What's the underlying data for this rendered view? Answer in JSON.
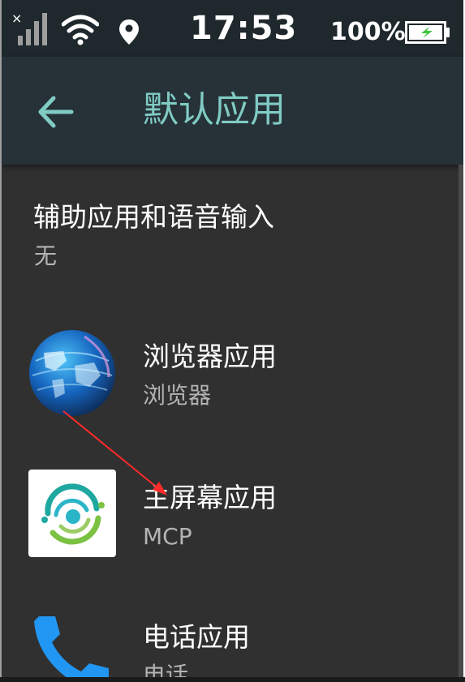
{
  "status_bar": {
    "time": "17:53",
    "battery_percent": "100%",
    "battery_level": 1.0,
    "icons": [
      "signal-no-service-icon",
      "wifi-icon",
      "location-icon",
      "battery-charging-icon"
    ]
  },
  "app_bar": {
    "back_icon": "arrow-back-icon",
    "title": "默认应用"
  },
  "items": [
    {
      "title": "辅助应用和语音输入",
      "subtitle": "无"
    },
    {
      "title": "浏览器应用",
      "subtitle": "浏览器",
      "icon": "browser-globe-icon"
    },
    {
      "title": "主屏幕应用",
      "subtitle": "MCP",
      "icon": "mcp-launcher-icon"
    },
    {
      "title": "电话应用",
      "subtitle": "电话",
      "icon": "phone-icon"
    }
  ],
  "colors": {
    "status_bar_bg": "#1f282c",
    "app_bar_bg": "#263238",
    "accent": "#80cbc4",
    "list_bg": "#303030",
    "annotation_arrow": "#ff2a2a"
  }
}
